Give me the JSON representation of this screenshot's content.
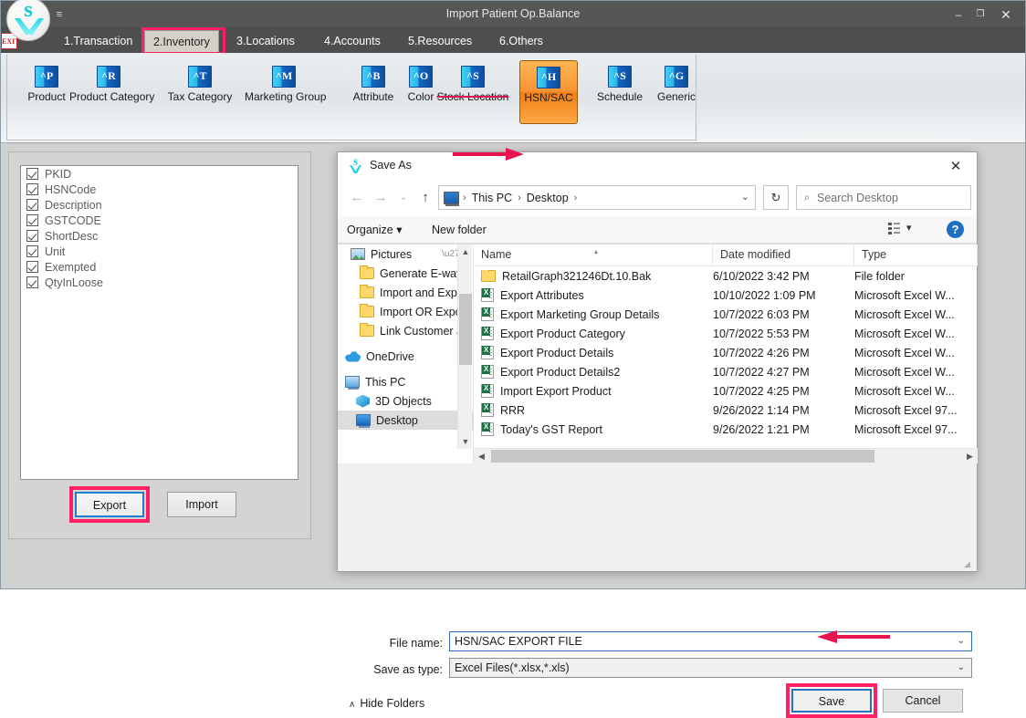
{
  "app": {
    "title": "Import Patient Op.Balance",
    "logo_letter": "S",
    "window_buttons": {
      "minimize": "–",
      "maximize": "❐",
      "close": "✕"
    },
    "quick_access_arrow": "≡",
    "tabs": [
      {
        "label": "1.Transaction",
        "selected": false
      },
      {
        "label": "2.Inventory",
        "selected": true
      },
      {
        "label": "3.Locations",
        "selected": false
      },
      {
        "label": "4.Accounts",
        "selected": false
      },
      {
        "label": "5.Resources",
        "selected": false
      },
      {
        "label": "6.Others",
        "selected": false
      }
    ],
    "title_icons": [
      {
        "name": "help-icon",
        "glyph": "?"
      },
      {
        "name": "document-icon",
        "glyph": ""
      },
      {
        "name": "exit-icon",
        "glyph": "EXIT"
      }
    ],
    "ribbon": [
      {
        "label": "Product",
        "glyph": "^P",
        "state": "normal"
      },
      {
        "label": "Product Category",
        "glyph": "^R",
        "state": "normal"
      },
      {
        "label": "Tax Category",
        "glyph": "^T",
        "state": "normal"
      },
      {
        "label": "Marketing Group",
        "glyph": "^M",
        "state": "normal"
      },
      {
        "label": "Attribute",
        "glyph": "^B",
        "state": "normal"
      },
      {
        "label": "Color",
        "glyph": "^O",
        "state": "normal"
      },
      {
        "label": "Stock Location",
        "glyph": "^S",
        "state": "strikethrough"
      },
      {
        "label": "HSN/SAC",
        "glyph": "^H",
        "state": "active"
      },
      {
        "label": "Schedule",
        "glyph": "^S",
        "state": "normal"
      },
      {
        "label": "Generic",
        "glyph": "^G",
        "state": "normal"
      }
    ]
  },
  "left_panel": {
    "fields": [
      {
        "label": "PKID",
        "checked": true
      },
      {
        "label": "HSNCode",
        "checked": true
      },
      {
        "label": "Description",
        "checked": true
      },
      {
        "label": "GSTCODE",
        "checked": true
      },
      {
        "label": "ShortDesc",
        "checked": true
      },
      {
        "label": "Unit",
        "checked": true
      },
      {
        "label": "Exempted",
        "checked": true
      },
      {
        "label": "QtyInLoose",
        "checked": true
      }
    ],
    "export_label": "Export",
    "import_label": "Import"
  },
  "dialog": {
    "title": "Save As",
    "close_glyph": "✕",
    "nav": {
      "back": "←",
      "forward": "→",
      "recent": "⌄",
      "up": "↑",
      "refresh": "↻",
      "dropdown": "⌄"
    },
    "breadcrumb": [
      "This PC",
      "Desktop"
    ],
    "breadcrumb_sep": "›",
    "search": {
      "placeholder": "Search Desktop",
      "icon": "⌕"
    },
    "commands": {
      "organize": "Organize ▾",
      "new_folder": "New folder",
      "view_chevron": "▾",
      "help": "?"
    },
    "nav_tree": [
      {
        "label": "Pictures",
        "icon": "pictures-icon",
        "indent": 14,
        "pinned": true,
        "selected": false
      },
      {
        "label": "Generate E-way",
        "icon": "folder-icon",
        "indent": 24,
        "pinned": false,
        "selected": false
      },
      {
        "label": "Import and Expo",
        "icon": "folder-icon",
        "indent": 24,
        "pinned": false,
        "selected": false
      },
      {
        "label": "Import OR Expor",
        "icon": "folder-icon",
        "indent": 24,
        "pinned": false,
        "selected": false
      },
      {
        "label": "Link Customer a",
        "icon": "folder-icon",
        "indent": 24,
        "pinned": false,
        "selected": false
      },
      {
        "label": "OneDrive",
        "icon": "onedrive-icon",
        "indent": 8,
        "pinned": false,
        "selected": false
      },
      {
        "label": "This PC",
        "icon": "pc-icon",
        "indent": 8,
        "pinned": false,
        "selected": false
      },
      {
        "label": "3D Objects",
        "icon": "cube-icon",
        "indent": 20,
        "pinned": false,
        "selected": false
      },
      {
        "label": "Desktop",
        "icon": "desktop-icon",
        "indent": 20,
        "pinned": false,
        "selected": true
      }
    ],
    "columns": [
      "Name",
      "Date modified",
      "Type"
    ],
    "sorted_column": "Name",
    "files": [
      {
        "name": "RetailGraph321246Dt.10.Bak",
        "date": "6/10/2022 3:42 PM",
        "type": "File folder",
        "icon": "folder-icon"
      },
      {
        "name": "Export Attributes",
        "date": "10/10/2022 1:09 PM",
        "type": "Microsoft Excel W...",
        "icon": "excel-icon"
      },
      {
        "name": "Export Marketing Group Details",
        "date": "10/7/2022 6:03 PM",
        "type": "Microsoft Excel W...",
        "icon": "excel-icon"
      },
      {
        "name": "Export Product Category",
        "date": "10/7/2022 5:53 PM",
        "type": "Microsoft Excel W...",
        "icon": "excel-icon"
      },
      {
        "name": "Export Product Details",
        "date": "10/7/2022 4:26 PM",
        "type": "Microsoft Excel W...",
        "icon": "excel-icon"
      },
      {
        "name": "Export Product Details2",
        "date": "10/7/2022 4:27 PM",
        "type": "Microsoft Excel W...",
        "icon": "excel-icon"
      },
      {
        "name": "Import Export Product",
        "date": "10/7/2022 4:25 PM",
        "type": "Microsoft Excel W...",
        "icon": "excel-icon"
      },
      {
        "name": "RRR",
        "date": "9/26/2022 1:14 PM",
        "type": "Microsoft Excel 97...",
        "icon": "excel-icon"
      },
      {
        "name": "Today's GST Report",
        "date": "9/26/2022 1:21 PM",
        "type": "Microsoft Excel 97...",
        "icon": "excel-icon"
      }
    ],
    "filename_label": "File name:",
    "filename_value": "HSN/SAC EXPORT FILE",
    "savetype_label": "Save as type:",
    "savetype_value": "Excel Files(*.xlsx,*.xls)",
    "hide_folders": "Hide Folders",
    "hide_folders_chevron": "∧",
    "save_label": "Save",
    "cancel_label": "Cancel"
  },
  "colors": {
    "highlight": "#ff1f63",
    "arrow": "#e8134f",
    "accent_orange": "#f79434",
    "focus_blue": "#2a6fb8"
  }
}
